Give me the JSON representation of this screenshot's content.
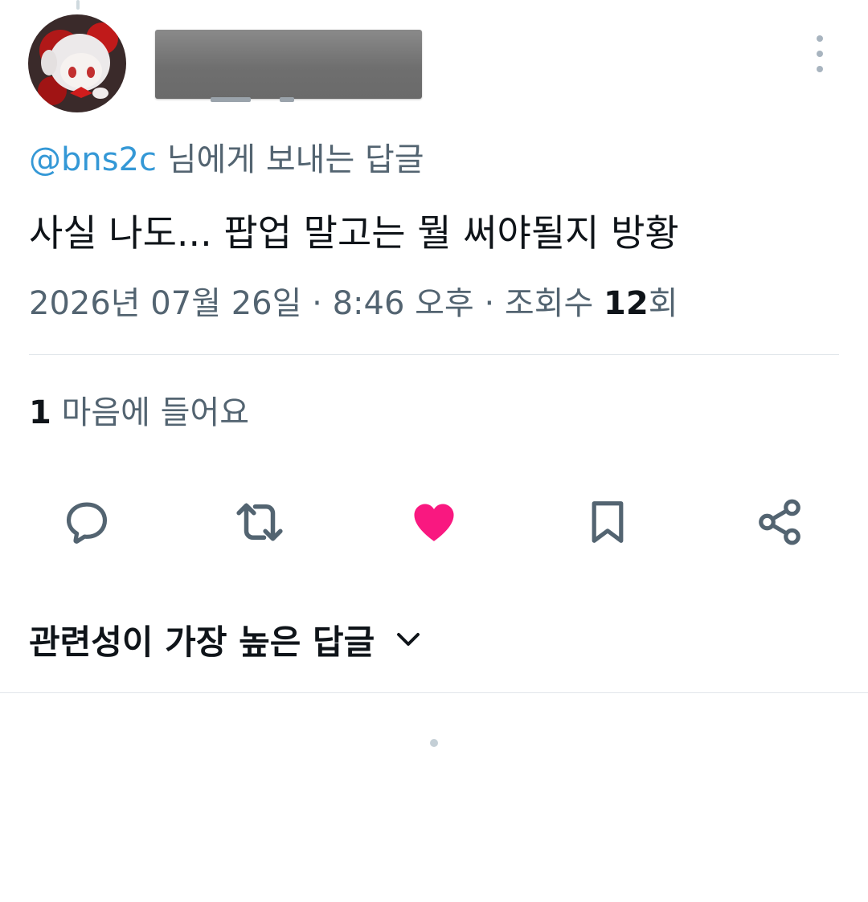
{
  "reply_context": {
    "handle": "@bns2c",
    "suffix": " 님에게 보내는 답글"
  },
  "tweet": {
    "text": "사실 나도... 팝업 말고는 뭘 써야될지 방황",
    "date": "2026년 07월 26일",
    "separator1": " · ",
    "time": "8:46 오후",
    "separator2": " · ",
    "views_prefix": "조회수 ",
    "views_count": "12",
    "views_suffix": "회"
  },
  "engagement": {
    "likes_count": "1",
    "likes_label": " 마음에 들어요"
  },
  "actions": {
    "reply_icon": "reply-icon",
    "retweet_icon": "retweet-icon",
    "like_icon": "heart-icon",
    "bookmark_icon": "bookmark-icon",
    "share_icon": "share-icon",
    "like_active": true,
    "like_color": "#f91880",
    "icon_color": "#536471"
  },
  "replies": {
    "sort_label": "관련성이 가장 높은 답글"
  },
  "colors": {
    "link": "#3498d6",
    "secondary_text": "#536471",
    "primary_text": "#0f1419",
    "divider": "#e1e6ea"
  }
}
